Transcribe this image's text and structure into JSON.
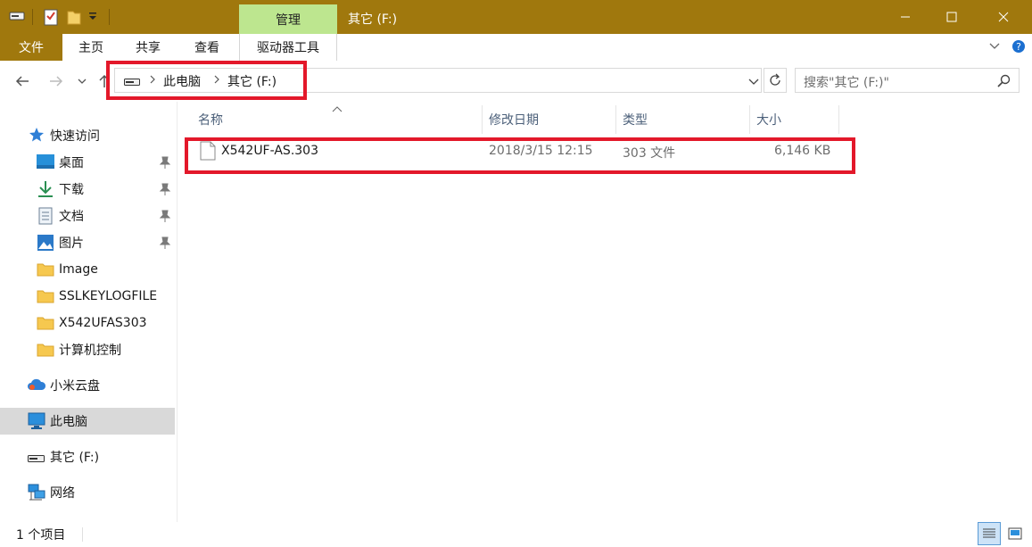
{
  "window": {
    "title": "其它 (F:)",
    "contextual_tab": "管理",
    "accent_color": "#a0780d",
    "contextual_color": "#bde68f"
  },
  "ribbon": {
    "tabs": [
      "文件",
      "主页",
      "共享",
      "查看",
      "驱动器工具"
    ]
  },
  "nav": {
    "breadcrumb": [
      "此电脑",
      "其它 (F:)"
    ],
    "search_placeholder": "搜索\"其它 (F:)\""
  },
  "sidebar": {
    "items": [
      {
        "label": "快速访问",
        "icon": "star-icon"
      },
      {
        "label": "桌面",
        "icon": "desktop-icon",
        "pinned": true
      },
      {
        "label": "下载",
        "icon": "download-icon",
        "pinned": true
      },
      {
        "label": "文档",
        "icon": "document-icon",
        "pinned": true
      },
      {
        "label": "图片",
        "icon": "pictures-icon",
        "pinned": true
      },
      {
        "label": "Image",
        "icon": "folder-icon"
      },
      {
        "label": "SSLKEYLOGFILE",
        "icon": "folder-icon"
      },
      {
        "label": "X542UFAS303",
        "icon": "folder-icon"
      },
      {
        "label": "计算机控制",
        "icon": "folder-icon"
      },
      {
        "label": "小米云盘",
        "icon": "cloud-icon"
      },
      {
        "label": "此电脑",
        "icon": "computer-icon",
        "selected": true
      },
      {
        "label": "其它 (F:)",
        "icon": "drive-icon"
      },
      {
        "label": "网络",
        "icon": "network-icon"
      }
    ]
  },
  "filelist": {
    "columns": [
      "名称",
      "修改日期",
      "类型",
      "大小"
    ],
    "rows": [
      {
        "name": "X542UF-AS.303",
        "modified": "2018/3/15 12:15",
        "type": "303 文件",
        "size": "6,146 KB"
      }
    ]
  },
  "status": {
    "item_count": "1 个项目"
  },
  "annotation_color": "#e3182a"
}
